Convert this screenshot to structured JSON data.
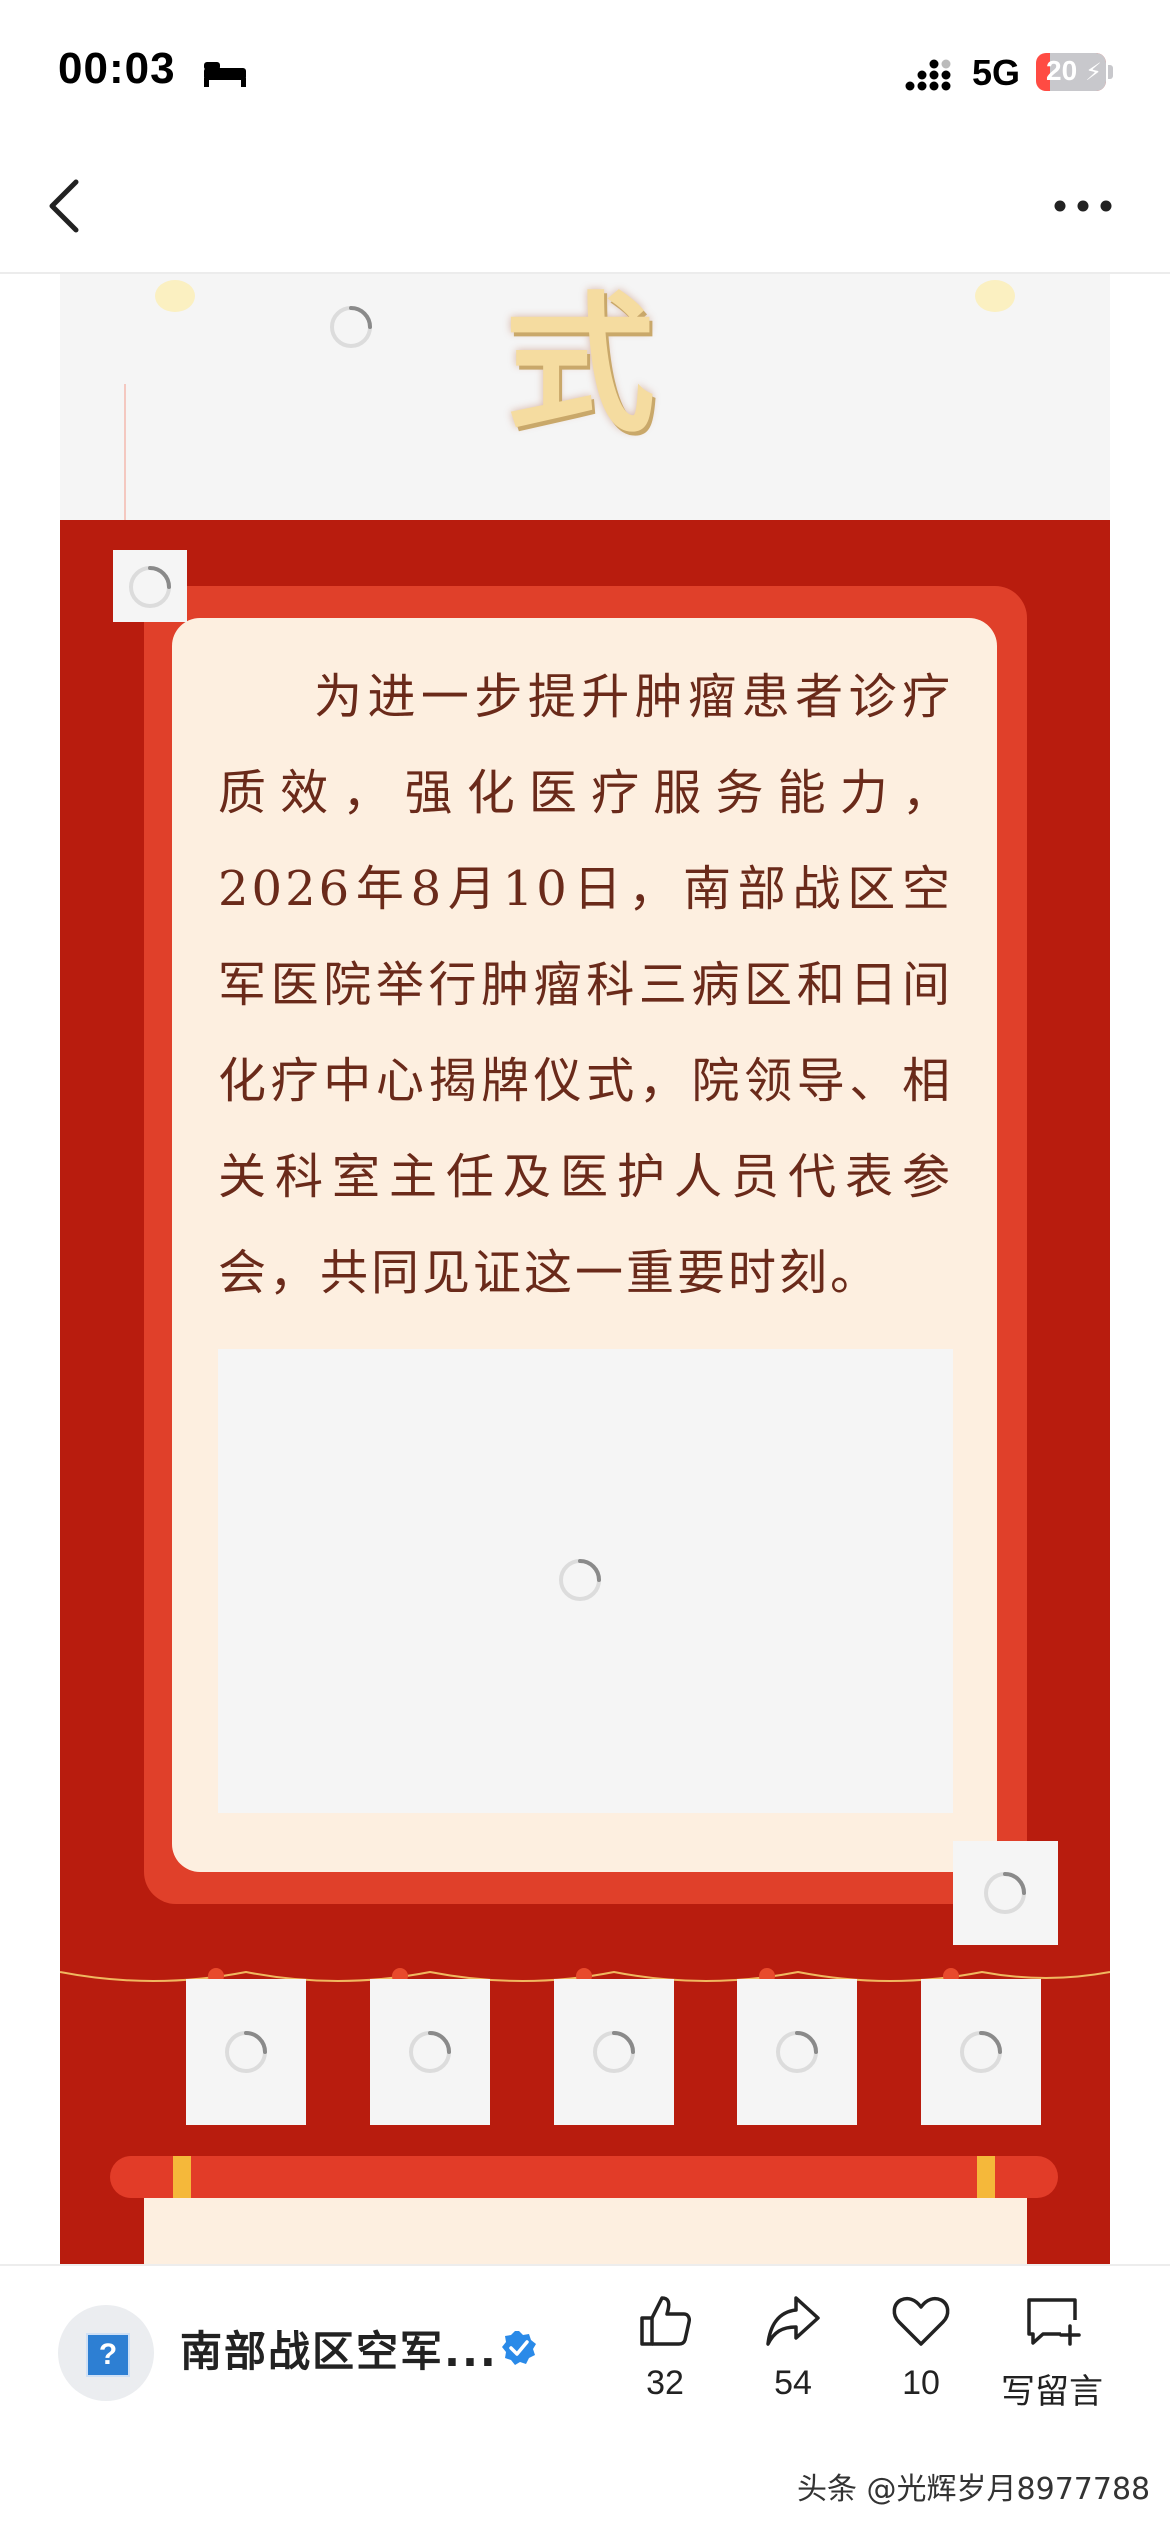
{
  "status_bar": {
    "time": "00:03",
    "network": "5G",
    "battery": "20",
    "battery_level": 0.2,
    "icons": [
      "sleep-mode-icon",
      "signal-icon",
      "battery-charging-icon"
    ]
  },
  "nav": {
    "back_icon": "chevron-left-icon",
    "more_icon": "more-dots-icon"
  },
  "article": {
    "banner_char": "式",
    "body": "为进一步提升肿瘤患者诊疗质效，强化医疗服务能力，2026年8月10日，南部战区空军医院举行肿瘤科三病区和日间化疗中心揭牌仪式，院领导、相关科室主任及医护人员代表参会，共同见证这一重要时刻。",
    "colors": {
      "background_red": "#b81c0e",
      "frame_red": "#e0402a",
      "paper": "#fdefe0",
      "text": "#6a2a1a",
      "gold": "#f5b83a"
    }
  },
  "footer": {
    "author_name": "南部战区空军...",
    "avatar_icon": "question-mark-icon",
    "verified_icon": "verified-check-icon",
    "likes": "32",
    "shares": "54",
    "favorites": "10",
    "comment_label": "写留言",
    "watermark": "头条 @光辉岁月8977788"
  }
}
